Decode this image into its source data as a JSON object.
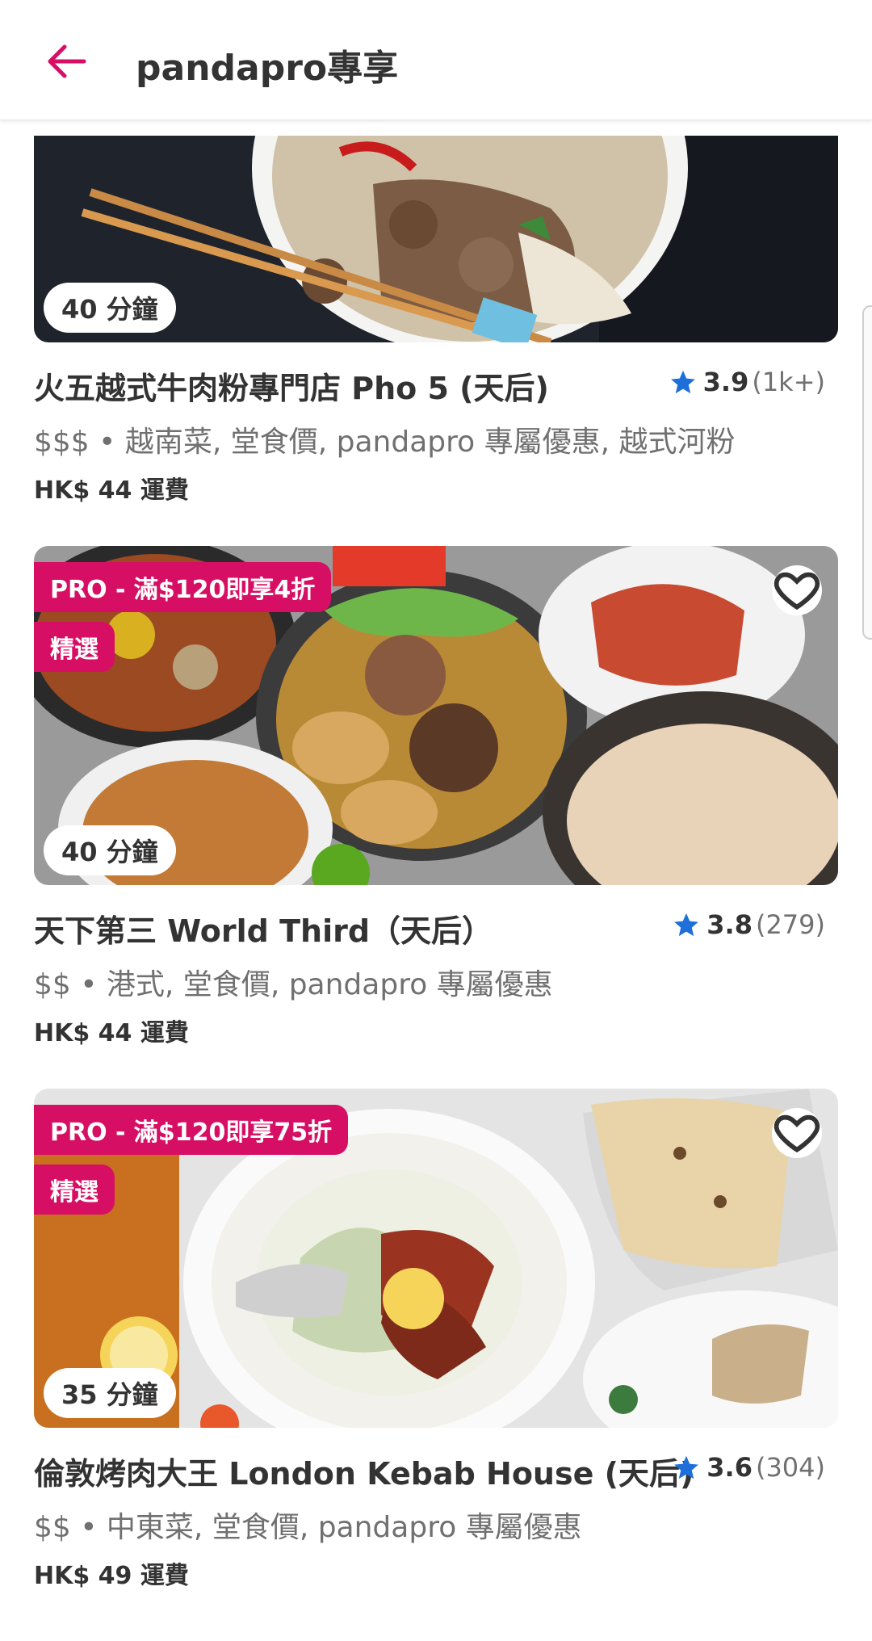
{
  "header": {
    "title": "pandapro專享"
  },
  "restaurants": [
    {
      "time": "40 分鐘",
      "name": "火五越式牛肉粉專門店 Pho 5 (天后)",
      "rating": "3.9",
      "rating_count": "(1k+)",
      "tags": "$$$ • 越南菜, 堂食價, pandapro 專屬優惠, 越式河粉",
      "fee": "HK$ 44 運費"
    },
    {
      "time": "40 分鐘",
      "promo": "PRO - 滿$120即享4折",
      "featured": "精選",
      "name": "天下第三 World Third（天后）",
      "rating": "3.8",
      "rating_count": "(279)",
      "tags": "$$ • 港式, 堂食價, pandapro 專屬優惠",
      "fee": "HK$ 44 運費"
    },
    {
      "time": "35 分鐘",
      "promo": "PRO - 滿$120即享75折",
      "featured": "精選",
      "name": "倫敦烤肉大王 London Kebab House (天后)",
      "rating": "3.6",
      "rating_count": "(304)",
      "tags": "$$ • 中東菜, 堂食價, pandapro 專屬優惠",
      "fee": "HK$ 49 運費"
    }
  ],
  "colors": {
    "brand": "#d70f64",
    "star": "#1e6fd9"
  },
  "icons": [
    "back-arrow-icon",
    "star-icon",
    "heart-icon"
  ]
}
